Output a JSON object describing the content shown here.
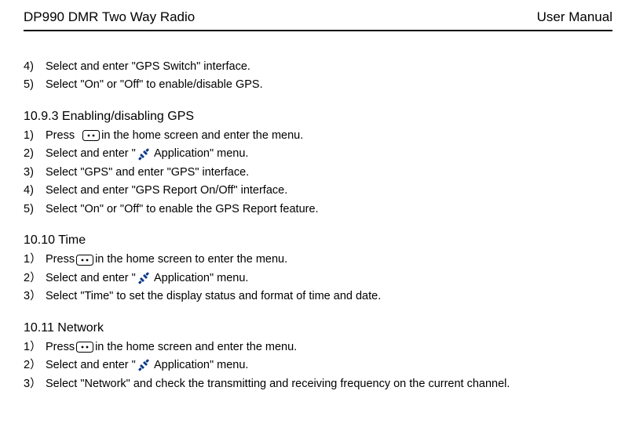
{
  "header": {
    "left": "DP990 DMR Two Way Radio",
    "right": "User Manual"
  },
  "block1": {
    "s4": {
      "num": "4)",
      "text": "Select and enter \"GPS Switch\" interface."
    },
    "s5": {
      "num": "5)",
      "text": "Select \"On\" or \"Off\" to enable/disable GPS."
    }
  },
  "sec1093": {
    "title": "10.9.3    Enabling/disabling GPS",
    "s1": {
      "num": "1)",
      "a": "Press  ",
      "b": "in the home screen and enter the menu."
    },
    "s2": {
      "num": "2)",
      "a": "Select and enter \"",
      "b": " Application\" menu."
    },
    "s3": {
      "num": "3)",
      "text": "Select \"GPS\" and enter \"GPS\" interface."
    },
    "s4": {
      "num": "4)",
      "text": "Select and enter \"GPS Report On/Off\" interface."
    },
    "s5": {
      "num": "5)",
      "text": "Select \"On\" or \"Off\" to enable the GPS Report feature."
    }
  },
  "sec1010": {
    "title": "10.10  Time",
    "s1": {
      "num": "1）",
      "a": "Press",
      "b": "in the home screen to enter the menu."
    },
    "s2": {
      "num": "2）",
      "a": "Select and enter \"",
      "b": " Application\" menu."
    },
    "s3": {
      "num": "3）",
      "text": "Select \"Time\" to set the display status and format of time and date."
    }
  },
  "sec1011": {
    "title": "10.11  Network",
    "s1": {
      "num": "1）",
      "a": "Press",
      "b": "in the home screen and enter the menu."
    },
    "s2": {
      "num": "2）",
      "a": "Select and enter \"",
      "b": " Application\" menu."
    },
    "s3": {
      "num": "3）",
      "text": "Select \"Network\" and check the transmitting and receiving frequency on the current channel."
    }
  }
}
